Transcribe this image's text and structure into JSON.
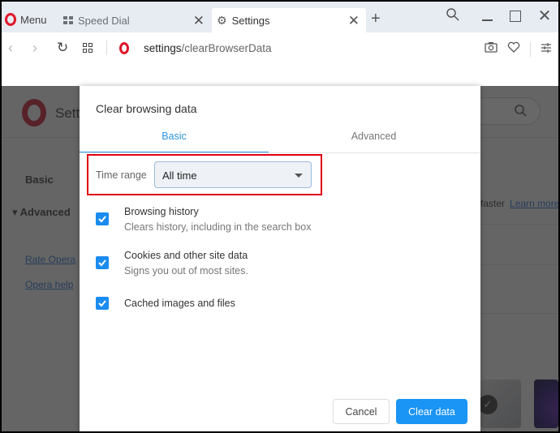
{
  "browser": {
    "menu_label": "Menu",
    "tabs": [
      {
        "label": "Speed Dial",
        "icon": "speed-dial-grid-icon",
        "active": false
      },
      {
        "label": "Settings",
        "icon": "gear-icon",
        "active": true
      }
    ],
    "new_tab_glyph": "+",
    "address": {
      "host": "settings",
      "path": "/clearBrowserData"
    },
    "toolbar_icons": [
      "camera-icon",
      "heart-icon",
      "easy-setup-icon"
    ]
  },
  "page": {
    "title": "Settings",
    "sidebar": {
      "basic": "Basic",
      "advanced": "Advanced",
      "links": [
        "Rate Opera",
        "Opera help"
      ]
    },
    "right_text": "faster",
    "right_link": "Learn more"
  },
  "dialog": {
    "title": "Clear browsing data",
    "tabs": [
      {
        "label": "Basic",
        "active": true
      },
      {
        "label": "Advanced",
        "active": false
      }
    ],
    "time_range": {
      "label": "Time range",
      "value": "All time"
    },
    "options": [
      {
        "label": "Browsing history",
        "description": "Clears history, including in the search box",
        "checked": true
      },
      {
        "label": "Cookies and other site data",
        "description": "Signs you out of most sites.",
        "checked": true
      },
      {
        "label": "Cached images and files",
        "description": "",
        "checked": true
      }
    ],
    "buttons": {
      "cancel": "Cancel",
      "clear": "Clear data"
    }
  },
  "colors": {
    "accent": "#1a94f5",
    "opera_red": "#e0162b",
    "highlight_box": "#e00010"
  }
}
